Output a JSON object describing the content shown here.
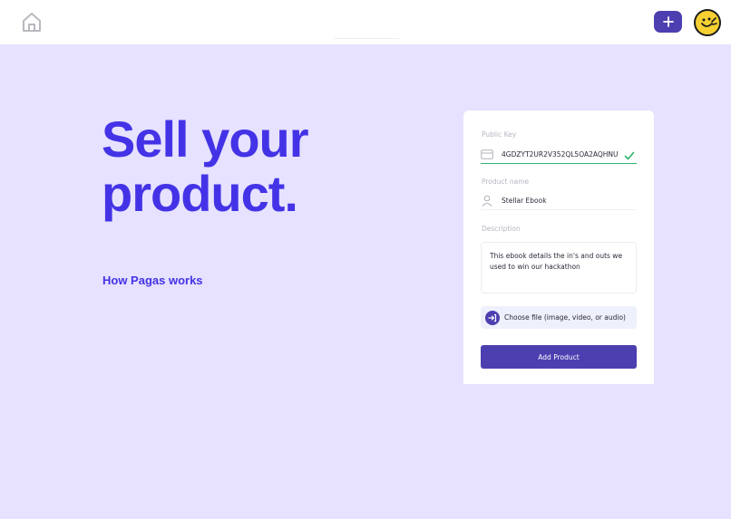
{
  "header": {
    "home_icon": "home-icon",
    "add_icon": "plus-icon",
    "avatar_icon": "smiley-avatar"
  },
  "hero": {
    "title_line1": "Sell your",
    "title_line2": "product.",
    "link": "How Pagas works"
  },
  "form": {
    "public_key": {
      "label": "Public Key",
      "value": "4GDZYT2UR2V352QL5OA2AQHNU",
      "icon": "card-icon",
      "valid_icon": "check-icon"
    },
    "product_name": {
      "label": "Product name",
      "value": "Stellar Ebook",
      "icon": "user-icon"
    },
    "description": {
      "label": "Description",
      "value": "This ebook details the in's and outs we used to win our hackathon"
    },
    "file": {
      "label": "Choose file (image, video, or audio)",
      "icon": "upload-arrow-icon"
    },
    "submit_label": "Add Product"
  },
  "colors": {
    "background": "#e6e2ff",
    "accent": "#4433e6",
    "button": "#4c3fb0",
    "success": "#2eb36b",
    "avatar": "#f6cf32"
  }
}
